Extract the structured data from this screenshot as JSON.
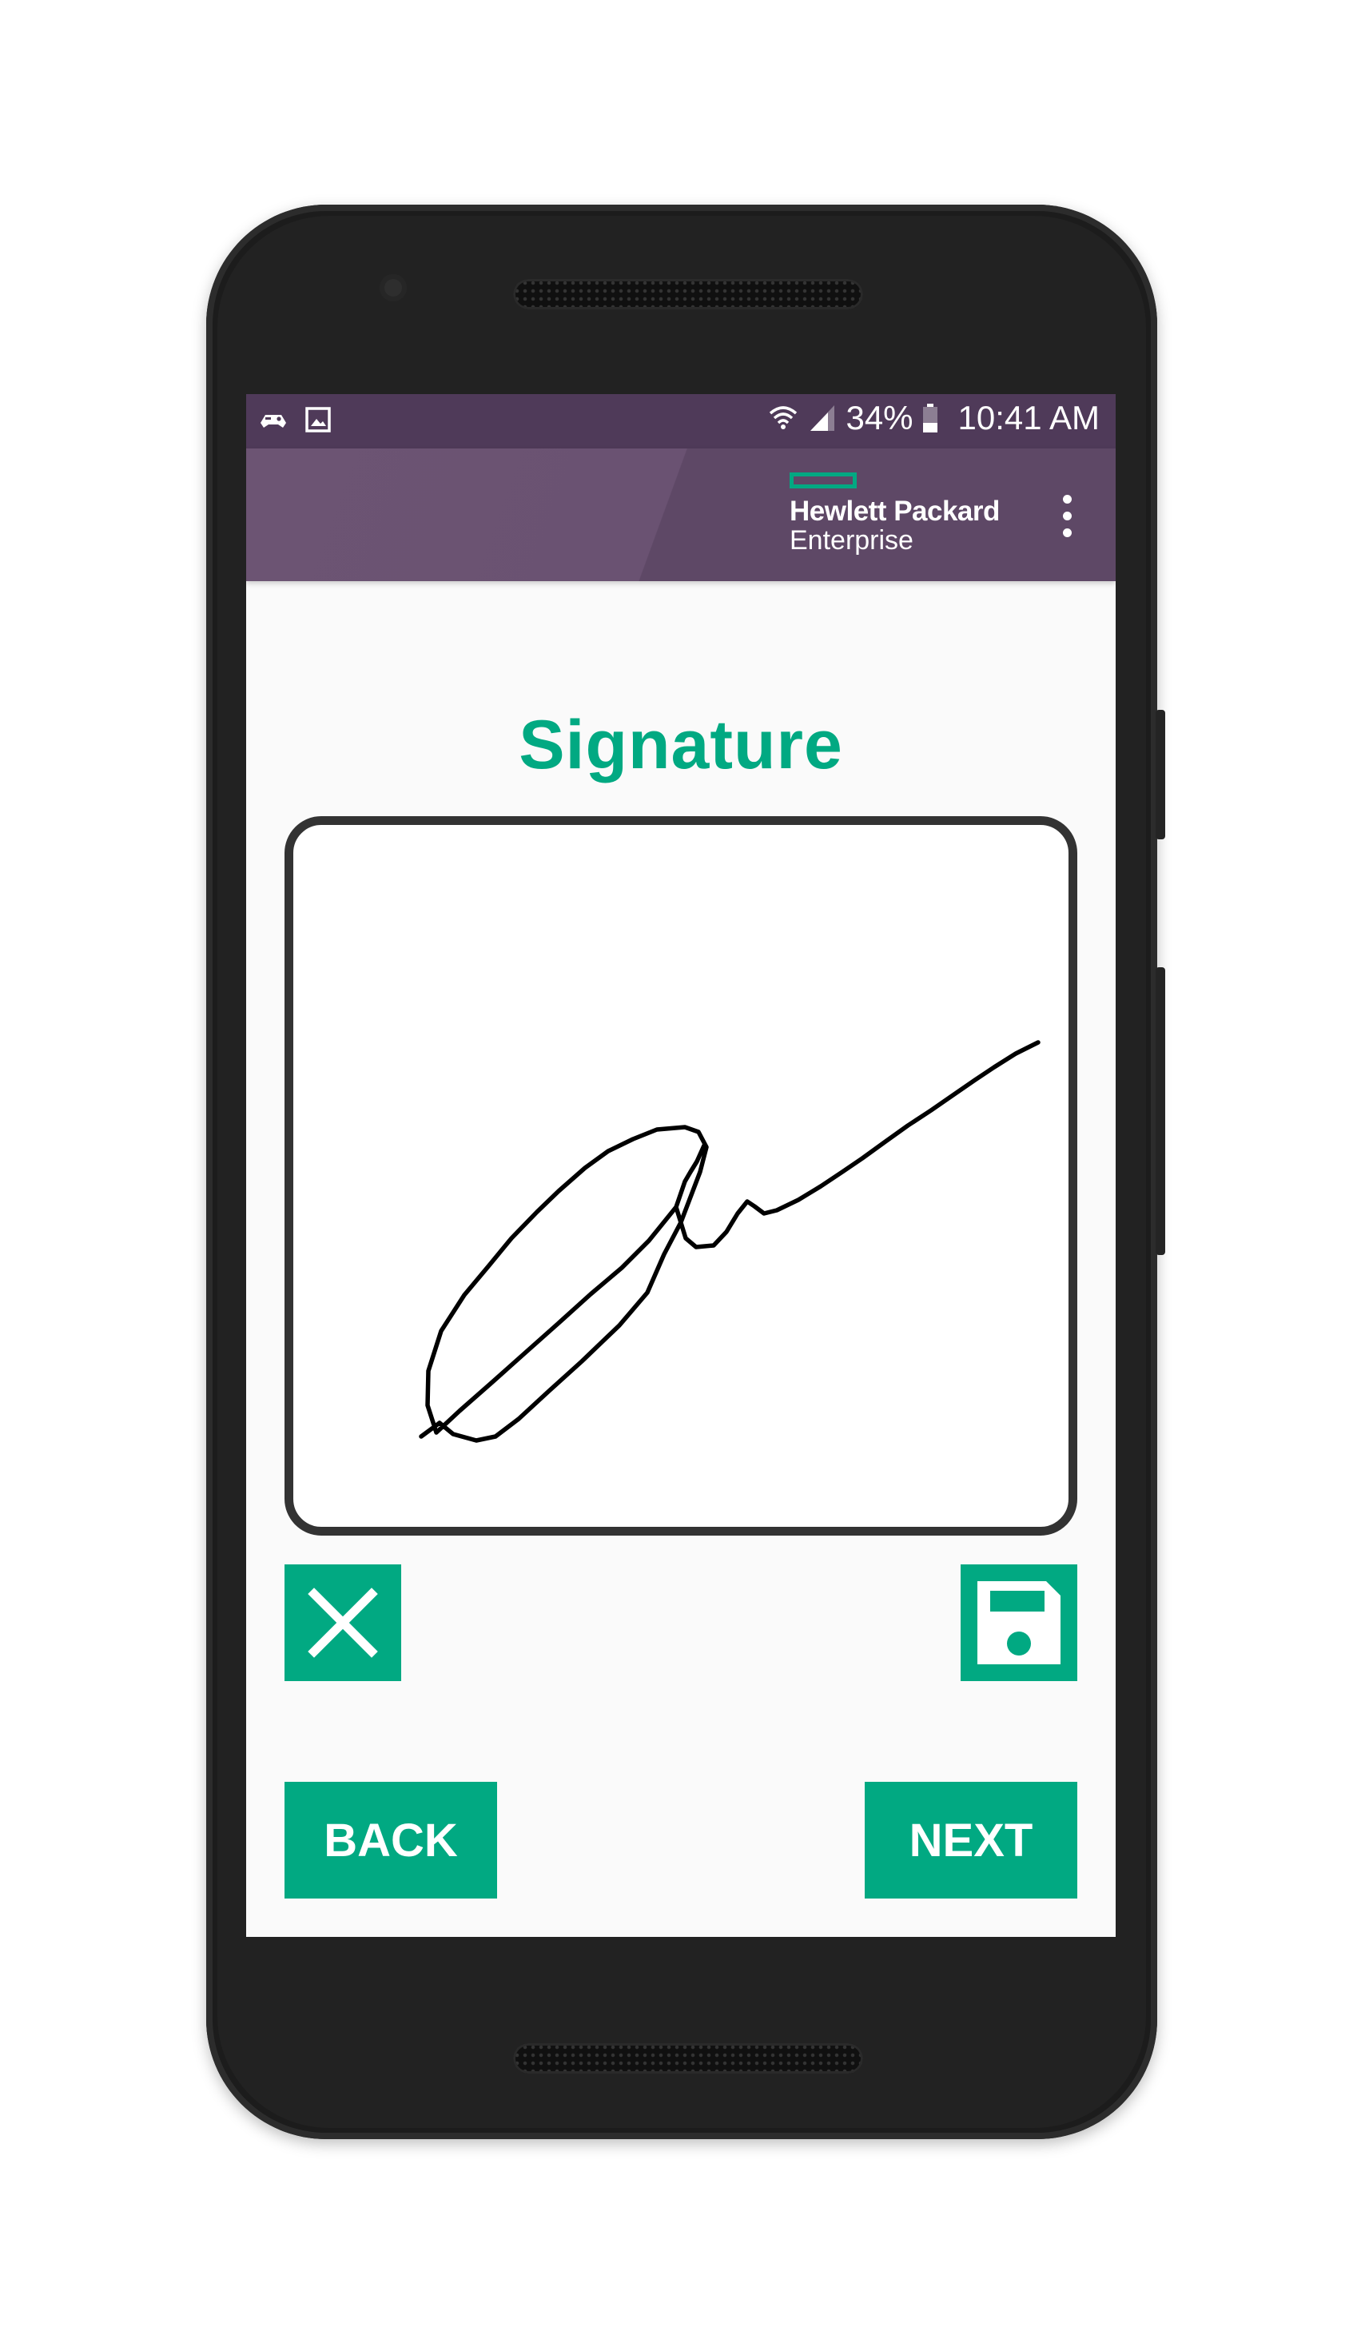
{
  "status_bar": {
    "left_icons": [
      "gamepad-notification-icon",
      "image-notification-icon"
    ],
    "right_icons": [
      "wifi-icon",
      "signal-icon",
      "battery-icon"
    ],
    "battery": "34%",
    "time": "10:41 AM"
  },
  "app_bar": {
    "logo_line1": "Hewlett Packard",
    "logo_line2": "Enterprise",
    "menu_icon": "overflow-menu-icon"
  },
  "main": {
    "title": "Signature",
    "clear_icon": "close-icon",
    "save_icon": "floppy-disk-icon",
    "back_label": "BACK",
    "next_label": "NEXT"
  },
  "colors": {
    "accent": "#01a982",
    "status_bar": "#4f3a59",
    "app_bar": "#6a5272",
    "signature_border": "#333333"
  }
}
